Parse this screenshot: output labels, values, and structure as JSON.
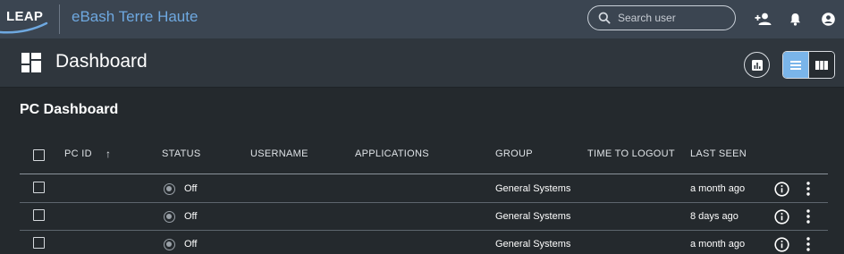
{
  "topbar": {
    "logo_text": "LEAP",
    "app_name": "eBash Terre Haute",
    "search_placeholder": "Search user",
    "icons": [
      "add-user-icon",
      "bell-icon",
      "account-icon"
    ]
  },
  "header": {
    "title": "Dashboard",
    "icons": [
      "dashboard-icon",
      "chart-icon",
      "list-view-icon",
      "grid-view-icon"
    ]
  },
  "section_title": "PC Dashboard",
  "table": {
    "columns": {
      "pc_id": "PC ID",
      "sort_indicator": "↑",
      "status": "STATUS",
      "username": "USERNAME",
      "applications": "APPLICATIONS",
      "group": "GROUP",
      "time_to_logout": "TIME TO LOGOUT",
      "last_seen": "LAST SEEN"
    },
    "rows": [
      {
        "pc_id": "",
        "status": "Off",
        "username": "",
        "applications": "",
        "group": "General Systems",
        "time_to_logout": "",
        "last_seen": "a month ago"
      },
      {
        "pc_id": "",
        "status": "Off",
        "username": "",
        "applications": "",
        "group": "General Systems",
        "time_to_logout": "",
        "last_seen": "8 days ago"
      },
      {
        "pc_id": "",
        "status": "Off",
        "username": "",
        "applications": "",
        "group": "General Systems",
        "time_to_logout": "",
        "last_seen": "a month ago"
      }
    ]
  },
  "colors": {
    "topbar_bg": "#3b4551",
    "app_name": "#6ea8e0",
    "body_bg": "#24292d",
    "header_bg": "#2f363d",
    "active_toggle": "#7ab5ea"
  }
}
